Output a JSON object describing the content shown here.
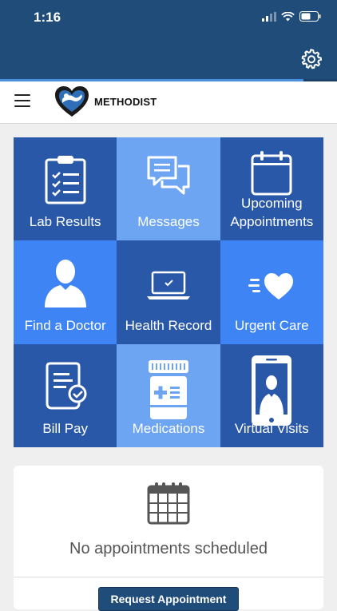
{
  "status_bar": {
    "time": "1:16"
  },
  "header": {
    "progress_fraction": 0.9
  },
  "brand": {
    "name": "METHODIST"
  },
  "tiles": [
    {
      "label": "Lab Results",
      "icon": "clipboard-checklist-icon",
      "color": "#2a58a8"
    },
    {
      "label": "Messages",
      "icon": "chat-bubbles-icon",
      "color": "#6ea5f3"
    },
    {
      "label": "Upcoming Appointments",
      "icon": "calendar-icon",
      "color": "#2a58a8"
    },
    {
      "label": "Find a Doctor",
      "icon": "doctor-person-icon",
      "color": "#3e84f4"
    },
    {
      "label": "Health Record",
      "icon": "laptop-icon",
      "color": "#2a58a8"
    },
    {
      "label": "Urgent Care",
      "icon": "heart-speed-icon",
      "color": "#3e84f4"
    },
    {
      "label": "Bill Pay",
      "icon": "receipt-icon",
      "color": "#2a58a8"
    },
    {
      "label": "Medications",
      "icon": "pill-bottle-icon",
      "color": "#6ea5f3"
    },
    {
      "label": "Virtual Visits",
      "icon": "phone-video-icon",
      "color": "#2a58a8"
    }
  ],
  "appointments": {
    "empty_text": "No appointments scheduled",
    "request_button": "Request Appointment"
  },
  "colors": {
    "header": "#1f4c78",
    "accent": "#4a8fdb"
  }
}
